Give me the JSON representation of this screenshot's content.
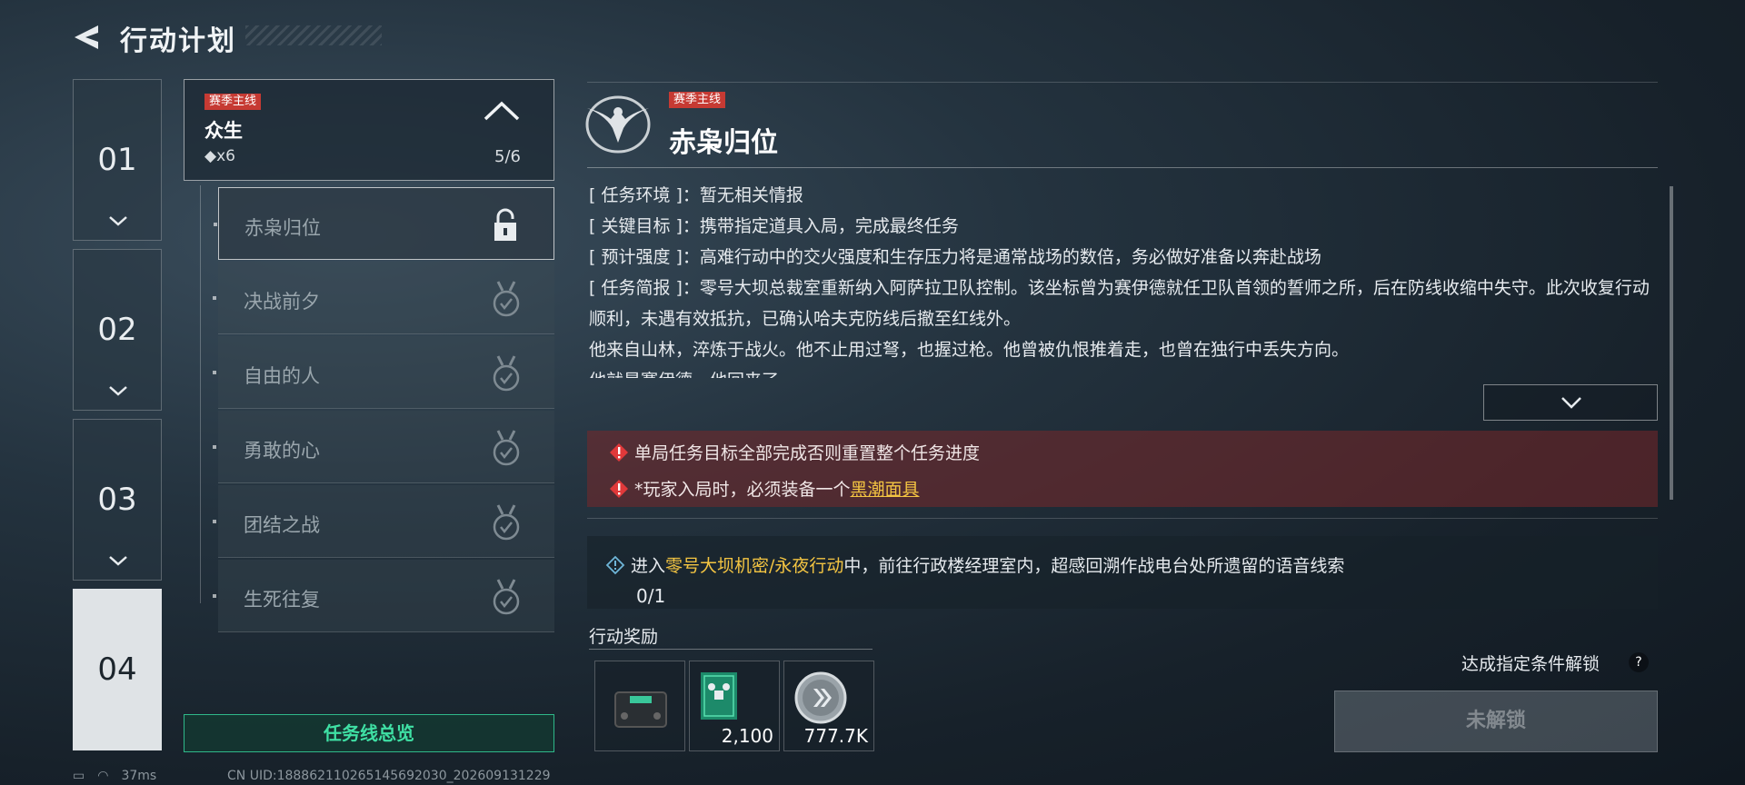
{
  "header": {
    "title": "行动计划"
  },
  "chapters": [
    {
      "num": "01",
      "active": false
    },
    {
      "num": "02",
      "active": false
    },
    {
      "num": "03",
      "active": false
    },
    {
      "num": "04",
      "active": true
    }
  ],
  "questline": {
    "tag": "赛季主线",
    "name": "众生",
    "count": "◆x6",
    "progress": "5/6"
  },
  "missions": [
    {
      "label": "赤枭归位",
      "status": "locked"
    },
    {
      "label": "决战前夕",
      "status": "completed"
    },
    {
      "label": "自由的人",
      "status": "completed"
    },
    {
      "label": "勇敢的心",
      "status": "completed"
    },
    {
      "label": "团结之战",
      "status": "completed"
    },
    {
      "label": "生死往复",
      "status": "completed"
    }
  ],
  "overview_button": "任务线总览",
  "detail": {
    "tag": "赛季主线",
    "title": "赤枭归位",
    "description": [
      "[ 任务环境 ]：暂无相关情报",
      "[ 关键目标 ]：携带指定道具入局，完成最终任务",
      "[ 预计强度 ]：高难行动中的交火强度和生存压力将是通常战场的数倍，务必做好准备以奔赴战场",
      "[ 任务简报 ]：零号大坝总裁室重新纳入阿萨拉卫队控制。该坐标曾为赛伊德就任卫队首领的誓师之所，后在防线收缩中失守。此次收复行动顺利，未遇有效抵抗，已确认哈夫克防线后撤至红线外。",
      "他来自山林，淬炼于战火。他不止用过弩，也握过枪。他曾被仇恨推着走，也曾在独行中丢失方向。",
      "他就是赛伊德，他回来了。"
    ],
    "warnings": {
      "line1": "单局任务目标全部完成否则重置整个任务进度",
      "line2_prefix": "*玩家入局时，必须装备一个",
      "line2_item": "黑潮面具"
    },
    "objective": {
      "prefix": "进入",
      "location": "零号大坝机密/永夜行动",
      "suffix": "中，前往行政楼经理室内，超感回溯作战电台处所遗留的语音线索",
      "progress": "0/1"
    },
    "rewards_label": "行动奖励",
    "rewards": [
      {
        "icon": "device-icon",
        "qty": ""
      },
      {
        "icon": "drone-card-icon",
        "qty": "2,100"
      },
      {
        "icon": "coin-icon",
        "qty": "777.7K"
      }
    ],
    "unlock_hint": "达成指定条件解锁",
    "help": "?",
    "locked_button": "未解锁"
  },
  "status_bar": {
    "ping": "37ms",
    "uid": "CN UID:188862110265145692030_202609131229"
  },
  "colors": {
    "accent_green": "#3fe0a4",
    "tag_red": "#c63a33",
    "highlight_yellow": "#f4c542",
    "warning_bg": "#78282a"
  }
}
